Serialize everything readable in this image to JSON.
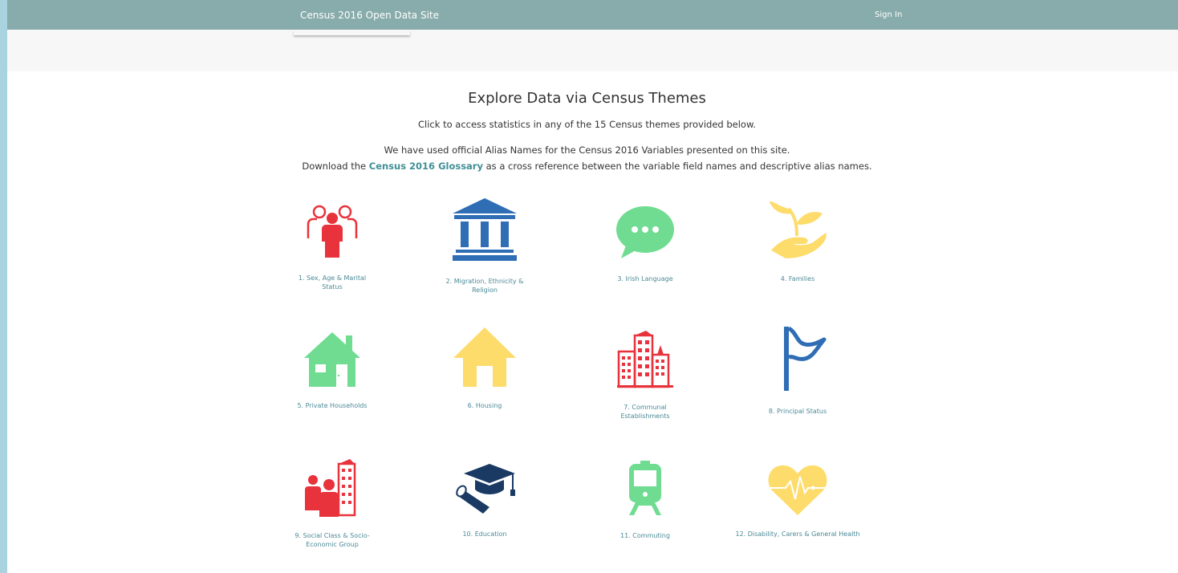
{
  "header": {
    "site_title": "Census 2016 Open Data Site",
    "sign_in": "Sign In"
  },
  "intro": {
    "heading": "Explore Data via Census Themes",
    "line1": "Click to access statistics in any of the 15 Census themes provided below.",
    "line2": "We have used official Alias Names for the Census 2016 Variables presented on this site.",
    "line3_prefix": "Download the ",
    "glossary_link": "Census 2016 Glossary",
    "line3_suffix": " as a cross reference between the variable field names and descriptive alias names."
  },
  "colors": {
    "red": "#e8323c",
    "blue": "#2f6db5",
    "green": "#6fdc92",
    "yellow": "#fddc6c",
    "navy": "#1b3a63",
    "topbar": "#88acab",
    "link": "#4b8a97"
  },
  "themes": [
    {
      "label": "1. Sex, Age & Marital Status",
      "icon": "people-icon"
    },
    {
      "label": "2. Migration, Ethnicity & Religion",
      "icon": "institution-icon"
    },
    {
      "label": "3. Irish Language",
      "icon": "speech-bubble-icon"
    },
    {
      "label": "4. Families",
      "icon": "plant-in-hand-icon"
    },
    {
      "label": "5. Private Households",
      "icon": "house-icon"
    },
    {
      "label": "6. Housing",
      "icon": "home-icon"
    },
    {
      "label": "7. Communal Establishments",
      "icon": "buildings-icon"
    },
    {
      "label": "8. Principal Status",
      "icon": "flag-icon"
    },
    {
      "label": "9. Social Class & Socio-Economic Group",
      "icon": "people-buildings-icon"
    },
    {
      "label": "10. Education",
      "icon": "graduation-icon"
    },
    {
      "label": "11. Commuting",
      "icon": "train-icon"
    },
    {
      "label": "12. Disability, Carers & General Health",
      "icon": "heart-pulse-icon"
    }
  ]
}
